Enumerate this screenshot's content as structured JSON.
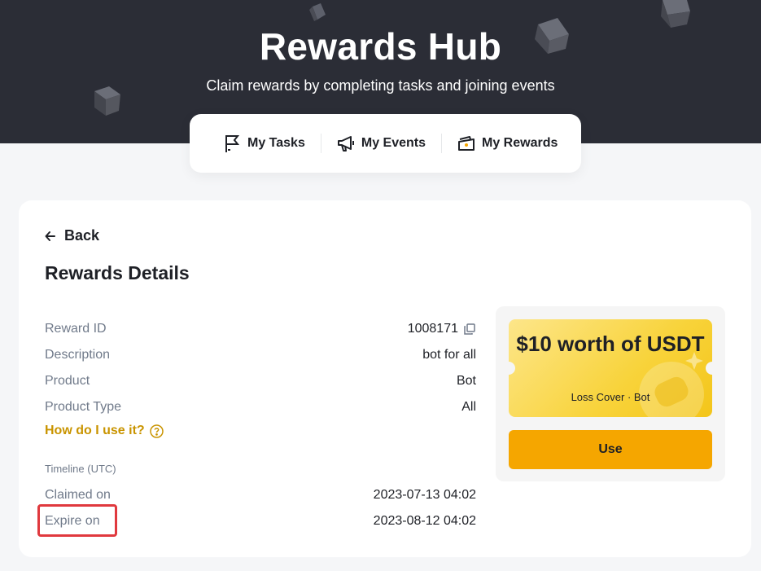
{
  "header": {
    "title": "Rewards Hub",
    "subtitle": "Claim rewards by completing tasks and joining events"
  },
  "tabs": [
    {
      "label": "My Tasks",
      "icon": "flag-icon"
    },
    {
      "label": "My Events",
      "icon": "megaphone-icon"
    },
    {
      "label": "My Rewards",
      "icon": "ticket-icon"
    }
  ],
  "details": {
    "back_label": "Back",
    "title": "Rewards Details",
    "fields": [
      {
        "label": "Reward ID",
        "value": "1008171"
      },
      {
        "label": "Description",
        "value": "bot for all"
      },
      {
        "label": "Product",
        "value": "Bot"
      },
      {
        "label": "Product Type",
        "value": "All"
      }
    ],
    "how_to_label": "How do I use it?",
    "timeline_label": "Timeline (UTC)",
    "timeline": [
      {
        "label": "Claimed on",
        "value": "2023-07-13 04:02"
      },
      {
        "label": "Expire on",
        "value": "2023-08-12 04:02"
      }
    ]
  },
  "coupon": {
    "amount": "$10 worth of USDT",
    "subtitle": "Loss Cover · Bot",
    "button_label": "Use"
  },
  "colors": {
    "header_bg": "#2b2d36",
    "accent": "#f5a600",
    "link": "#c99400",
    "highlight": "#e0393e"
  }
}
